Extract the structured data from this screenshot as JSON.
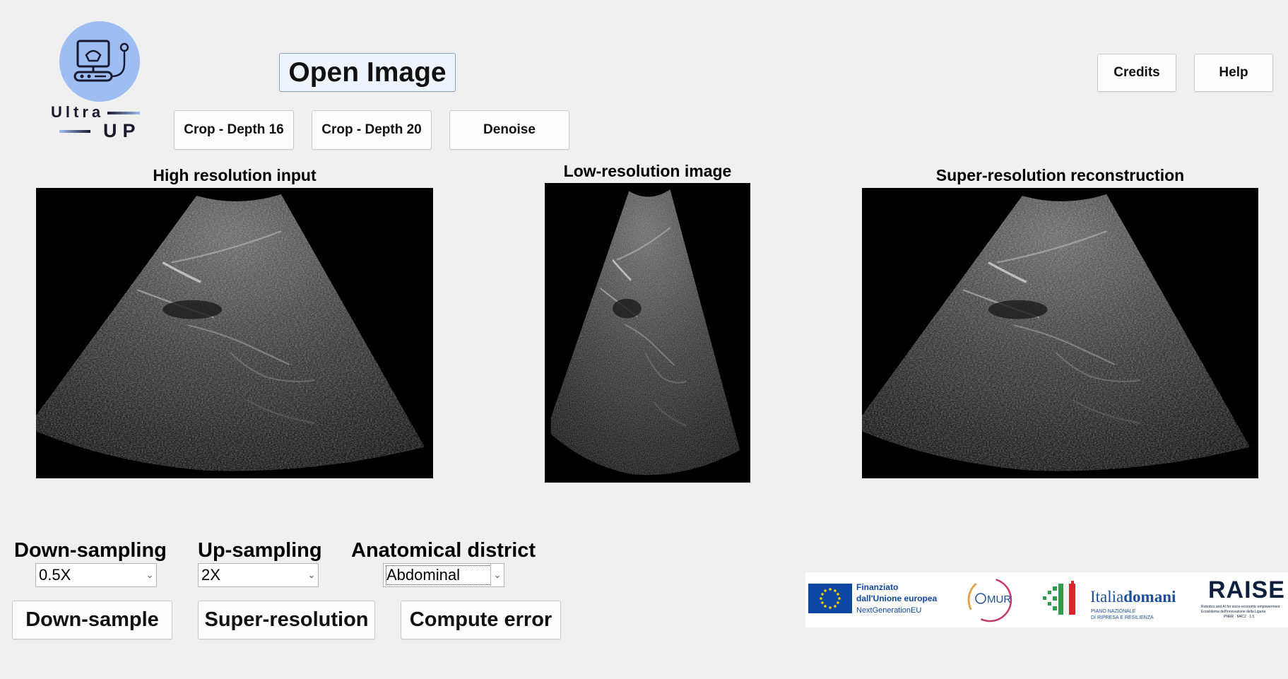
{
  "logo": {
    "line1": "Ultra",
    "line2": "UP",
    "circle_color": "#9ebdf3"
  },
  "top": {
    "open_image": "Open Image",
    "crop16": "Crop - Depth 16",
    "crop20": "Crop - Depth 20",
    "denoise": "Denoise",
    "credits": "Credits",
    "help": "Help"
  },
  "panels": {
    "hr_title": "High resolution input",
    "lr_title": "Low-resolution image",
    "sr_title": "Super-resolution reconstruction"
  },
  "controls": {
    "down_label": "Down-sampling",
    "down_value": "0.5X",
    "up_label": "Up-sampling",
    "up_value": "2X",
    "district_label": "Anatomical district",
    "district_value": "Abdominal",
    "downsample_btn": "Down-sample",
    "superres_btn": "Super-resolution",
    "error_btn": "Compute error"
  },
  "sponsors": {
    "eu_line1": "Finanziato",
    "eu_line2": "dall'Unione europea",
    "eu_line3": "NextGenerationEU",
    "mur": "MUR",
    "italia_a": "Italia",
    "italia_b": "domani",
    "italia_sub1": "PIANO NAZIONALE",
    "italia_sub2": "DI RIPRESA E RESILIENZA",
    "raise": "RAISE",
    "raise_sub1": "Robotics and AI for socio-economic empowerment",
    "raise_sub2": "Ecosistema dell'innovazione della Liguria",
    "raise_sub3": "PNRR · M4C2 · 1.5"
  },
  "colors": {
    "eu_blue": "#0e47a1",
    "eu_star": "#ffcc00",
    "mur_blue": "#1b4f9c",
    "italia_green": "#2e9e4a",
    "italia_red": "#d8262d",
    "raise_navy": "#0c1f3f"
  }
}
